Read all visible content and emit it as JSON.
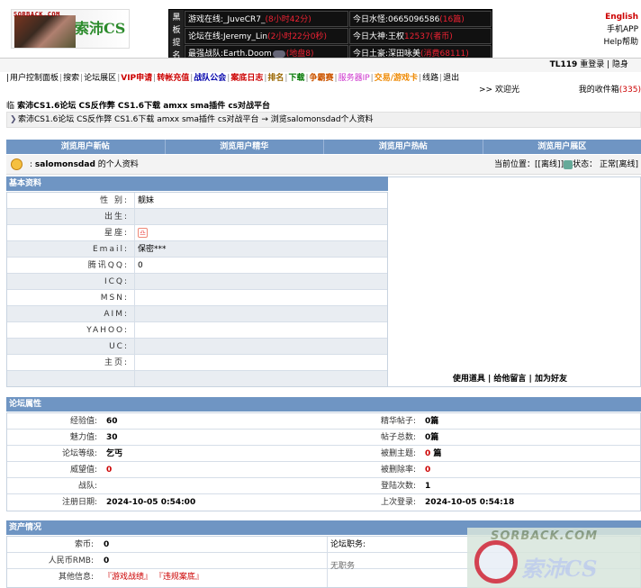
{
  "header": {
    "logo_site": "SORBACK.COM",
    "logo_brand": "索沛CS",
    "notice_side": [
      "黑",
      "板",
      "提",
      "名"
    ],
    "notice": {
      "r1c1_a": "游戏在线:_JuveCR7_",
      "r1c1_b": "(8小时42分)",
      "r1c2_a": "今日水怪:0665096586",
      "r1c2_b": "(16篇)",
      "r2c1_a": "论坛在线:Jeremy_Lin",
      "r2c1_b": "(2小时22分0秒)",
      "r2c2_a": "今日大神:王权",
      "r2c2_b": "12537(者币)",
      "r3c1_a": "最强战队:Earth.Doom",
      "r3c1_b": "(地盘8)",
      "r3c2_a": "今日土豪:深田咏美",
      "r3c2_b": "(消费68111)"
    },
    "lang_english": "English",
    "lang_app": "手机APP",
    "lang_help": "Help帮助"
  },
  "userbar": {
    "user": "TL119",
    "relogin": "重登录",
    "hide": "隐身"
  },
  "menu": [
    "用户控制面板",
    "搜索",
    "论坛展区",
    "VIP申请",
    "转帐充值",
    "战队公会",
    "案底日志",
    "排名",
    "下载",
    "争霸赛",
    "服务器IP",
    "交易/游戏卡",
    "线路",
    "退出"
  ],
  "welcome": ">> 欢迎光",
  "inbox_label": "我的收件箱",
  "inbox_count": "(335)",
  "page_title_prefix": "临",
  "page_title": "索沛CS1.6论坛 CS反作弊 CS1.6下载 amxx sma插件 cs对战平台",
  "breadcrumb": "索沛CS1.6论坛 CS反作弊 CS1.6下载 amxx sma插件 cs对战平台 → 浏览salomonsdad个人资料",
  "tabs": [
    "浏览用户新帖",
    "浏览用户精华",
    "浏览用户热帖",
    "浏览用户展区"
  ],
  "profile_header": {
    "name": "salomonsdad",
    "suffix": "的个人资料",
    "location_label": "当前位置：",
    "location_value": "[[离线]]",
    "status_label": "状态：",
    "status_value": "正常[离线]"
  },
  "basic": {
    "title": "基本资料",
    "rows": [
      {
        "label": "性 别:",
        "value": "靓妹"
      },
      {
        "label": "出生:",
        "value": ""
      },
      {
        "label": "星座:",
        "value": ""
      },
      {
        "label": "Email:",
        "value": "保密***"
      },
      {
        "label": "腾讯QQ:",
        "value": "0"
      },
      {
        "label": "ICQ:",
        "value": ""
      },
      {
        "label": "MSN:",
        "value": ""
      },
      {
        "label": "AIM:",
        "value": ""
      },
      {
        "label": "YAHOO:",
        "value": ""
      },
      {
        "label": "UC:",
        "value": ""
      },
      {
        "label": "主页:",
        "value": ""
      }
    ],
    "actions": [
      "使用道具",
      "给他留言",
      "加为好友"
    ]
  },
  "forum": {
    "title": "论坛属性",
    "rows": [
      {
        "label": "经验值:",
        "value": "60",
        "label2": "精华帖子:",
        "value2": "0篇"
      },
      {
        "label": "魅力值:",
        "value": "30",
        "label2": "帖子总数:",
        "value2": "0篇"
      },
      {
        "label": "论坛等级:",
        "value": "乞丐",
        "label2": "被删主题:",
        "value2": "0",
        "value2b": "篇"
      },
      {
        "label": "威望值:",
        "value": "0",
        "label2": "被删除率:",
        "value2": "0"
      },
      {
        "label": "战队:",
        "value": "",
        "label2": "登陆次数:",
        "value2": "1"
      },
      {
        "label": "注册日期:",
        "value": "2024-10-05 0:54:00",
        "label2": "上次登录:",
        "value2": "2024-10-05 0:54:18"
      }
    ]
  },
  "assets": {
    "title": "资产情况",
    "rows": [
      {
        "label": "索币:",
        "value": "0"
      },
      {
        "label": "人民币RMB:",
        "value": "0"
      },
      {
        "label": "其他信息:",
        "value": "『游戏战绩』 『违规案底』"
      }
    ],
    "post_label": "论坛职务:",
    "post_value": "无职务"
  },
  "watermark": {
    "top": "SORBACK.COM",
    "bottom": "索沛CS"
  }
}
